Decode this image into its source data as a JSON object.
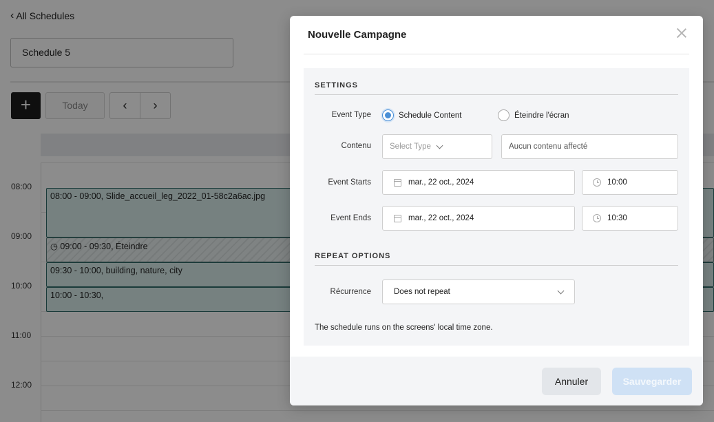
{
  "page": {
    "back_link": "All Schedules",
    "schedule_name": "Schedule 5",
    "toolbar": {
      "add_label": "+",
      "today_label": "Today",
      "prev_label": "‹",
      "next_label": "›"
    },
    "time_labels": [
      "08:00",
      "09:00",
      "10:00",
      "11:00",
      "12:00"
    ],
    "events": [
      {
        "time": "08:00 - 09:00,",
        "title": "Slide_accueil_leg_2022_01-58c2a6ac.jpg"
      },
      {
        "time": "09:00 - 09:30,",
        "title": "Éteindre"
      },
      {
        "time": "09:30 - 10:00,",
        "title": "building, nature, city"
      },
      {
        "time": "10:00 - 10:30,",
        "title": ""
      }
    ]
  },
  "modal": {
    "title": "Nouvelle Campagne",
    "settings_heading": "SETTINGS",
    "event_type": {
      "label": "Event Type",
      "options": [
        "Schedule Content",
        "Éteindre l'écran"
      ],
      "selected": "Schedule Content"
    },
    "contenu": {
      "label": "Contenu",
      "type_placeholder": "Select Type",
      "content_placeholder": "Aucun contenu affecté"
    },
    "event_starts": {
      "label": "Event Starts",
      "date": "mar., 22 oct., 2024",
      "time": "10:00"
    },
    "event_ends": {
      "label": "Event Ends",
      "date": "mar., 22 oct., 2024",
      "time": "10:30"
    },
    "repeat_heading": "REPEAT OPTIONS",
    "recurrence": {
      "label": "Récurrence",
      "value": "Does not repeat"
    },
    "timezone_note": "The schedule runs on the screens' local time zone.",
    "cancel_label": "Annuler",
    "save_label": "Sauvegarder"
  },
  "colors": {
    "accent": "#4a8fd6",
    "event_fill": "#d7ecea",
    "event_border": "#2e6b68",
    "save_disabled": "#cfe1f5"
  }
}
